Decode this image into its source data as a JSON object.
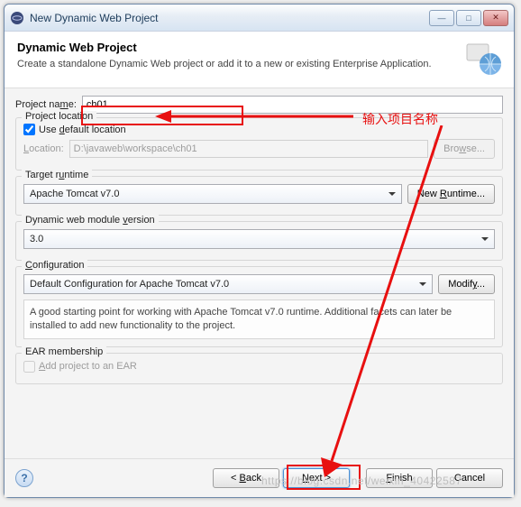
{
  "titlebar": {
    "title": "New Dynamic Web Project"
  },
  "header": {
    "title": "Dynamic Web Project",
    "desc": "Create a standalone Dynamic Web project or add it to a new or existing Enterprise Application."
  },
  "project_name": {
    "label": "Project na",
    "mnemonic": "m",
    "label_after": "e:",
    "value": "ch01"
  },
  "location": {
    "group_title": "Project location",
    "use_default_pre": "Use ",
    "use_default_m": "d",
    "use_default_post": "efault location",
    "loc_label_pre": "",
    "loc_label_m": "L",
    "loc_label_post": "ocation:",
    "path": "D:\\javaweb\\workspace\\ch01",
    "browse_pre": "Bro",
    "browse_m": "w",
    "browse_post": "se..."
  },
  "runtime": {
    "group_title": "Target r",
    "group_title_m": "u",
    "group_title_post": "ntime",
    "selected": "Apache Tomcat v7.0",
    "new_pre": "New ",
    "new_m": "R",
    "new_post": "untime..."
  },
  "module": {
    "group_title": "Dynamic web module ",
    "group_title_m": "v",
    "group_title_post": "ersion",
    "selected": "3.0"
  },
  "config": {
    "group_title_m": "C",
    "group_title_post": "onfiguration",
    "selected": "Default Configuration for Apache Tomcat v7.0",
    "modify_pre": "Modif",
    "modify_m": "y",
    "modify_post": "...",
    "desc": "A good starting point for working with Apache Tomcat v7.0 runtime. Additional facets can later be installed to add new functionality to the project."
  },
  "ear": {
    "group_title": "EAR membership",
    "add_pre": "",
    "add_m": "A",
    "add_post": "dd project to an EAR"
  },
  "footer": {
    "back_pre": "< ",
    "back_m": "B",
    "back_post": "ack",
    "next_pre": "",
    "next_m": "N",
    "next_post": "ext >",
    "finish_pre": "",
    "finish_m": "F",
    "finish_post": "inish",
    "cancel": "Cancel"
  },
  "annotations": {
    "label": "输入项目名称"
  },
  "watermark": "https://blog.csdn.net/weixin_40422587"
}
